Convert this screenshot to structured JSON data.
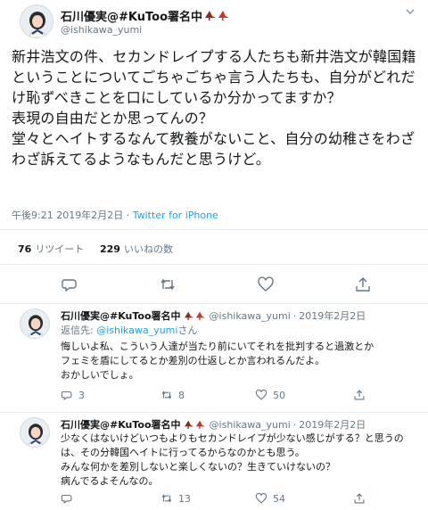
{
  "main_tweet": {
    "display_name": "石川優実@#KuToo署名中",
    "handle": "@ishikawa_yumi",
    "text": "新井浩文の件、セカンドレイプする人たちも新井浩文が韓国籍ということについてごちゃごちゃ言う人たちも、自分がどれだけ恥ずべきことを口にしているか分かってますか？\n表現の自由だとか思ってんの？\n堂々とヘイトするなんて教養がないこと、自分の幼稚さをわざわざ訴えてるようなもんだと思うけど。",
    "time": "午後9:21",
    "date": "2019年2月2日",
    "separator": "·",
    "source": "Twitter for iPhone",
    "retweets_count": "76",
    "retweets_label": "リツイート",
    "likes_count": "229",
    "likes_label": "いいねの数"
  },
  "replies": [
    {
      "display_name": "石川優実@#KuToo署名中",
      "handle": "@ishikawa_yumi",
      "separator": "·",
      "date": "2019年2月2日",
      "replying_label": "返信先:",
      "replying_to": "@ishikawa_yumi",
      "replying_suffix": "さん",
      "text": "悔しいよ私、こういう人達が当たり前にいてそれを批判すると過激とか\nフェミを盾にしてるとか差別の仕返しとか言われるんだよ。\nおかしいでしょ。",
      "reply_count": "3",
      "retweet_count": "8",
      "like_count": "50"
    },
    {
      "display_name": "石川優実@#KuToo署名中",
      "handle": "@ishikawa_yumi",
      "separator": "·",
      "date": "2019年2月2日",
      "text": "少なくはないけどいつもよりもセカンドレイプが少ない感じがする？と思うのは、その分韓国ヘイトに行ってるからなのかとも思う。\nみんな何かを差別しないと楽しくないの？生きていけないの？\n病んでるよそんなの。",
      "reply_count": "",
      "retweet_count": "13",
      "like_count": "54"
    }
  ],
  "colors": {
    "accent": "#1da1f2",
    "text": "#14171a",
    "muted": "#657786",
    "heel": "#c0392b"
  },
  "icons": [
    "chevron-down-icon",
    "reply-icon",
    "retweet-icon",
    "like-icon",
    "share-icon",
    "high-heel-icon"
  ]
}
